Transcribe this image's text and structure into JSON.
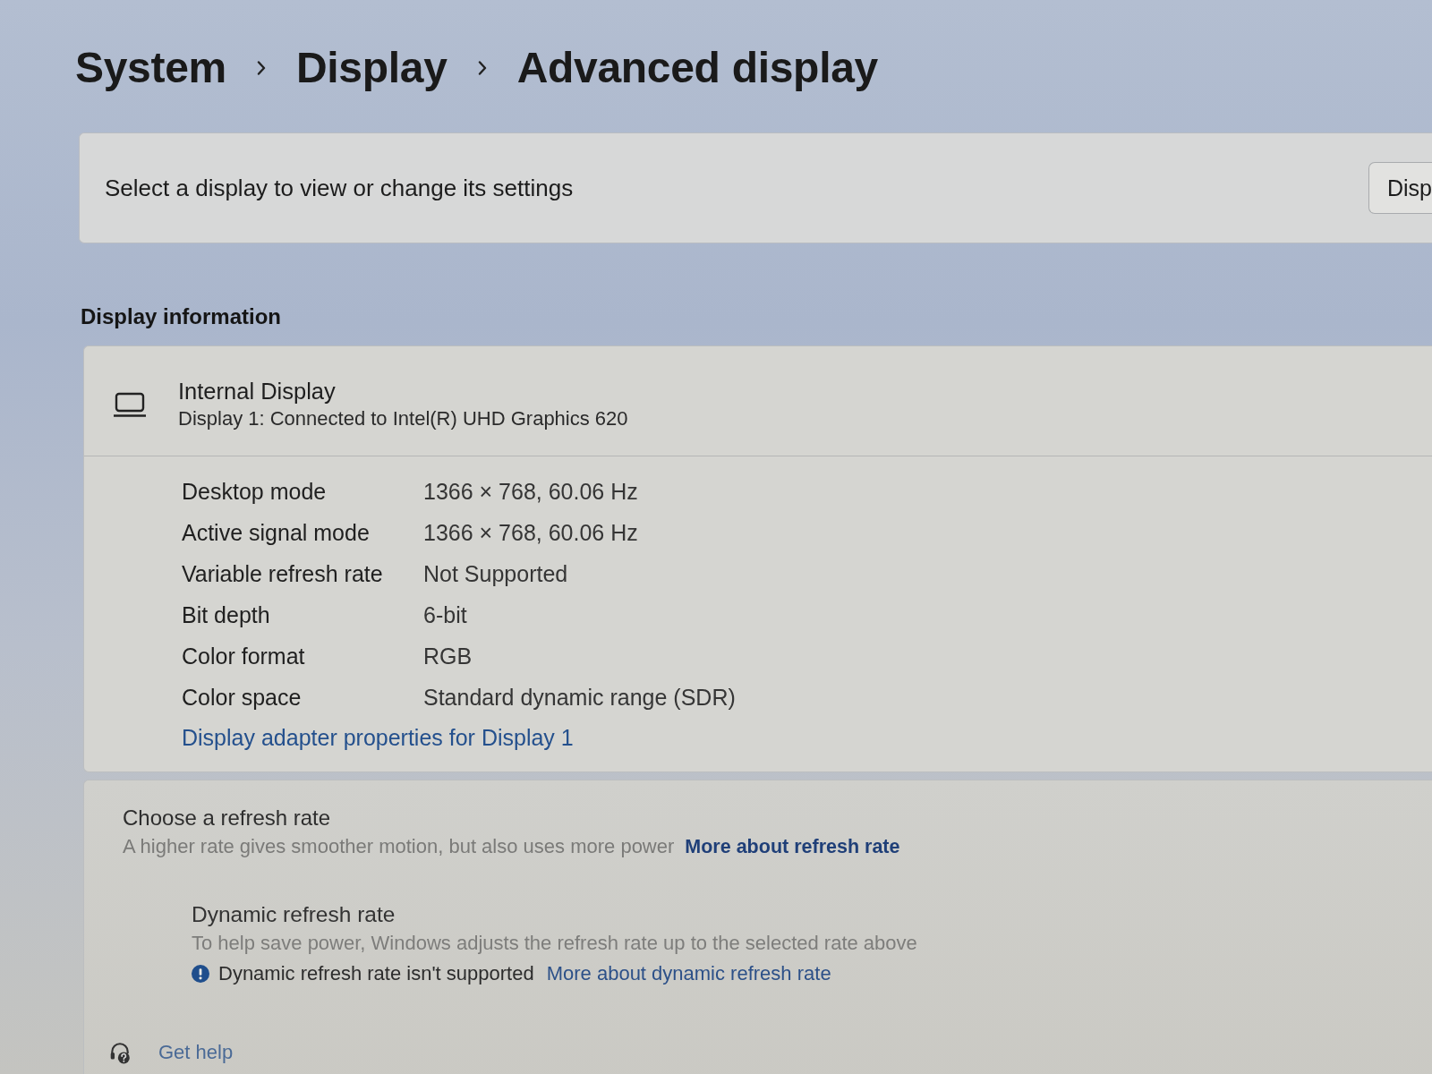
{
  "breadcrumb": [
    {
      "label": "System"
    },
    {
      "label": "Display"
    },
    {
      "label": "Advanced display"
    }
  ],
  "display_selector": {
    "label": "Select a display to view or change its settings",
    "button": "Disp"
  },
  "display_information": {
    "heading": "Display information",
    "display_name": "Internal Display",
    "description": "Display 1: Connected to Intel(R) UHD Graphics 620",
    "rows": [
      {
        "label": "Desktop mode",
        "value": "1366 × 768, 60.06 Hz"
      },
      {
        "label": "Active signal mode",
        "value": "1366 × 768, 60.06 Hz"
      },
      {
        "label": "Variable refresh rate",
        "value": "Not Supported"
      },
      {
        "label": "Bit depth",
        "value": "6-bit"
      },
      {
        "label": "Color format",
        "value": "RGB"
      },
      {
        "label": "Color space",
        "value": "Standard dynamic range (SDR)"
      }
    ],
    "link": "Display adapter properties for Display 1"
  },
  "refresh_rate": {
    "title": "Choose a refresh rate",
    "description": "A higher rate gives smoother motion, but also uses more power",
    "link": "More about refresh rate"
  },
  "dynamic_refresh_rate": {
    "title": "Dynamic refresh rate",
    "description": "To help save power, Windows adjusts the refresh rate up to the selected rate above",
    "notice": "Dynamic refresh rate isn't supported",
    "link": "More about dynamic refresh rate"
  },
  "help": {
    "label": "Get help"
  }
}
